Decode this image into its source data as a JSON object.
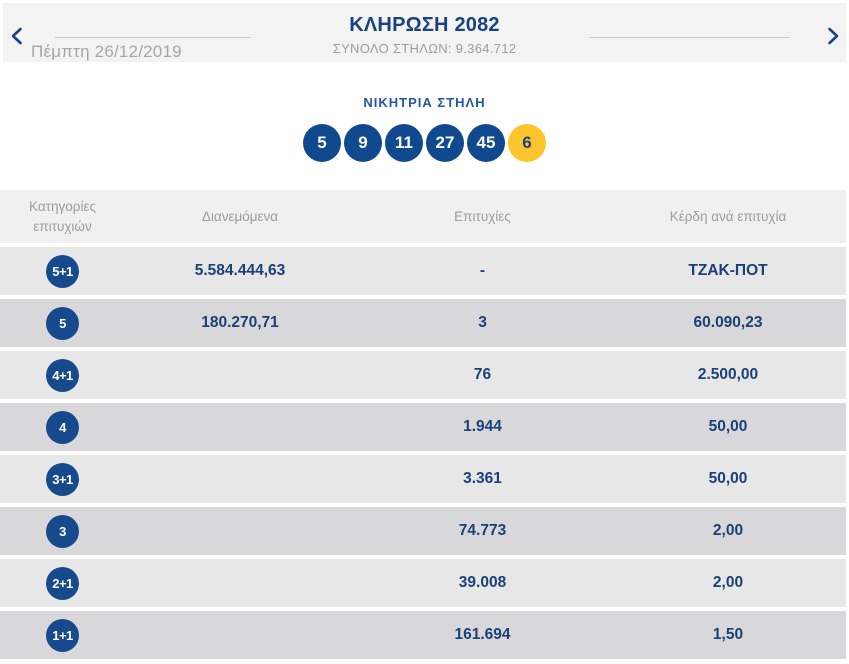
{
  "header": {
    "title": "ΚΛΗΡΩΣΗ 2082",
    "total_columns_label": "ΣΥΝΟΛΟ ΣΤΗΛΩΝ: 9.364.712",
    "date": "Πέμπτη 26/12/2019"
  },
  "winning_column": {
    "title": "ΝΙΚΗΤΡΙΑ ΣΤΗΛΗ",
    "numbers": [
      "5",
      "9",
      "11",
      "27",
      "45"
    ],
    "bonus_number": "6"
  },
  "table": {
    "headers": [
      "Κατηγορίες επιτυχιών",
      "Διανεμόμενα",
      "Επιτυχίες",
      "Κέρδη ανά επιτυχία"
    ],
    "rows": [
      {
        "category": "5+1",
        "distributed": "5.584.444,63",
        "winners": "-",
        "prize": "ΤΖΑΚ-ΠΟΤ"
      },
      {
        "category": "5",
        "distributed": "180.270,71",
        "winners": "3",
        "prize": "60.090,23"
      },
      {
        "category": "4+1",
        "distributed": "",
        "winners": "76",
        "prize": "2.500,00"
      },
      {
        "category": "4",
        "distributed": "",
        "winners": "1.944",
        "prize": "50,00"
      },
      {
        "category": "3+1",
        "distributed": "",
        "winners": "3.361",
        "prize": "50,00"
      },
      {
        "category": "3",
        "distributed": "",
        "winners": "74.773",
        "prize": "2,00"
      },
      {
        "category": "2+1",
        "distributed": "",
        "winners": "39.008",
        "prize": "2,00"
      },
      {
        "category": "1+1",
        "distributed": "",
        "winners": "161.694",
        "prize": "1,50"
      }
    ]
  },
  "colors": {
    "navy_text": "#1b4280",
    "ball_blue": "#11498e",
    "bonus_yellow": "#fdc52d",
    "section_title_blue": "#2456a3",
    "muted_gray": "#9d9da0",
    "row_light": "#e7e7e8",
    "row_dark": "#d8d8da",
    "header_row_bg": "#f0f0f1"
  }
}
